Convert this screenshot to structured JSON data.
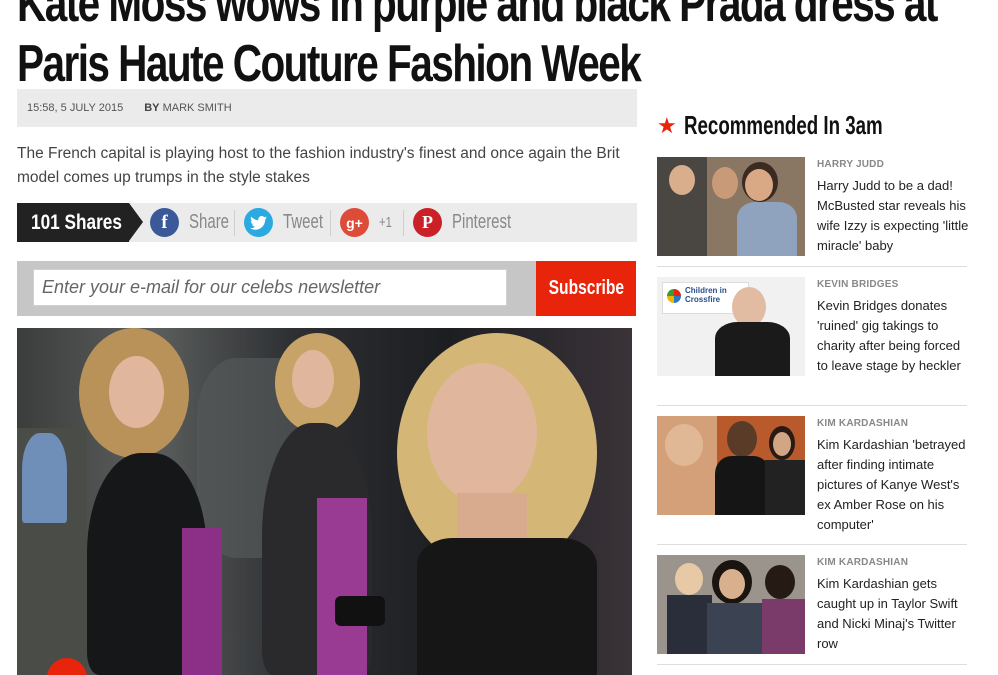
{
  "article": {
    "headline_line1": "Kate Moss wows in purple and black Prada dress at",
    "headline_line2": "Paris Haute Couture Fashion Week",
    "timestamp": "15:58, 5 JULY 2015",
    "author_prefix": "BY",
    "author": "MARK SMITH",
    "standfirst": "The French capital is playing host to the fashion industry's finest and once again the Brit model comes up trumps in the style stakes"
  },
  "share": {
    "count_label": "101 Shares",
    "items": [
      {
        "label": "Share",
        "icon": "facebook-icon",
        "glyph": "f",
        "color": "#3b5998"
      },
      {
        "label": "Tweet",
        "icon": "twitter-icon",
        "glyph": "t",
        "color": "#2ba9e1"
      },
      {
        "label": "+1",
        "icon": "google-plus-icon",
        "glyph": "g+",
        "color": "#dd4b39"
      },
      {
        "label": "Pinterest",
        "icon": "pinterest-icon",
        "glyph": "P",
        "color": "#cb2027"
      }
    ]
  },
  "newsletter": {
    "placeholder": "Enter your e-mail for our celebs newsletter",
    "button_label": "Subscribe"
  },
  "sidebar": {
    "title": "Recommended In 3am",
    "items": [
      {
        "tag": "HARRY JUDD",
        "story": "Harry Judd to be a dad! McBusted star reveals his wife Izzy is expecting 'little miracle' baby"
      },
      {
        "tag": "KEVIN BRIDGES",
        "story": "Kevin Bridges donates 'ruined' gig takings to charity after being forced to leave stage by heckler",
        "logo_text": "Children in Crossfire"
      },
      {
        "tag": "KIM KARDASHIAN",
        "story": "Kim Kardashian 'betrayed after finding intimate pictures of Kanye West's ex Amber Rose on his computer'"
      },
      {
        "tag": "KIM KARDASHIAN",
        "story": "Kim Kardashian gets caught up in Taylor Swift and Nicki Minaj's Twitter row"
      }
    ]
  },
  "colors": {
    "accent": "#e8240a",
    "dark": "#222222",
    "bar": "#ebebeb"
  }
}
